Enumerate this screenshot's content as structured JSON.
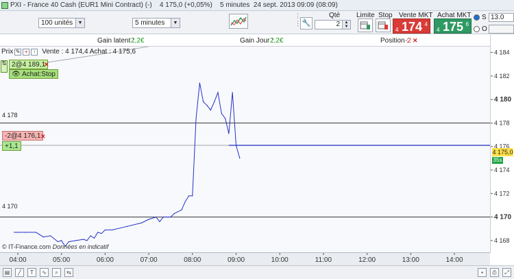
{
  "title": {
    "app": "PXI",
    "instrument": "France 40 Cash (EUR1 Mini Contract) (-)",
    "last": "4 175,0 (+0,05%)",
    "interval": "5 minutes",
    "datetime": "24 sept. 2013 09:09 (08:09)"
  },
  "toolbar": {
    "units_value": "100 unités",
    "timeframe_value": "5 minutes",
    "qty_label": "Qté",
    "qty_value": "2",
    "limit_label": "Limite",
    "stop_label": "Stop",
    "sell_label": "Vente MKT",
    "buy_label": "Achat MKT",
    "sell_prefix": "4",
    "sell_big": "174",
    "sell_suffix": "4",
    "buy_prefix": "4",
    "buy_big": "175",
    "buy_suffix": "6",
    "radio_s": "S",
    "radio_o": "O",
    "step_value": "13.0",
    "step_value2": "",
    "colors": {
      "sell": "#d93b36",
      "buy": "#2f9a63"
    }
  },
  "info": {
    "gain_latent_label": "Gain latent :",
    "gain_latent_value": "2,2€",
    "gain_jour_label": "Gain Jour :",
    "gain_jour_value": "2,2€",
    "position_label": "Position :",
    "position_value": "-2"
  },
  "panel": {
    "prix_label": "Prix",
    "quote": "Vente : 4 174,4 Achat : 4 175,6",
    "pos_order": "2@4 189,1",
    "stop_order": "Achat:Stop",
    "sell_order": "-2@4 176,1",
    "pnl": "+1,1",
    "watermark": "© IT-Finance.com",
    "watermark_note": "Données en indicatif"
  },
  "levels": {
    "line1_label": "4 178",
    "line2_label": "4 170",
    "current_price": "4 175,0",
    "current_badge": "35s"
  },
  "chart_data": {
    "type": "line",
    "title": "",
    "xlabel": "",
    "ylabel": "",
    "x_ticks": [
      "04:00",
      "05:00",
      "06:00",
      "07:00",
      "08:00",
      "09:00",
      "10:00",
      "11:00",
      "12:00",
      "13:00",
      "14:00"
    ],
    "y_ticks": [
      "4 184",
      "4 182",
      "4 180",
      "4 178",
      "4 176",
      "4 174",
      "4 172",
      "4 170",
      "4 168"
    ],
    "ylim": [
      4167,
      4184.5
    ],
    "horizontal_levels": [
      4178,
      4176.1,
      4170
    ],
    "series": [
      {
        "name": "",
        "color": "#2330c8",
        "points": [
          [
            "03:55",
            4168.7
          ],
          [
            "04:00",
            4168.7
          ],
          [
            "04:10",
            4168.7
          ],
          [
            "04:25",
            4168.7
          ],
          [
            "04:35",
            4168.3
          ],
          [
            "04:45",
            4168.4
          ],
          [
            "04:55",
            4167.9
          ],
          [
            "05:00",
            4168.0
          ],
          [
            "05:05",
            4167.5
          ],
          [
            "05:10",
            4167.9
          ],
          [
            "05:20",
            4168.0
          ],
          [
            "05:30",
            4168.1
          ],
          [
            "05:35",
            4168.0
          ],
          [
            "05:40",
            4168.4
          ],
          [
            "05:45",
            4168.2
          ],
          [
            "05:50",
            4168.7
          ],
          [
            "05:55",
            4168.6
          ],
          [
            "06:00",
            4168.9
          ],
          [
            "06:10",
            4168.9
          ],
          [
            "06:30",
            4169.2
          ],
          [
            "06:50",
            4169.5
          ],
          [
            "07:00",
            4169.8
          ],
          [
            "07:10",
            4170.0
          ],
          [
            "07:15",
            4169.6
          ],
          [
            "07:20",
            4170.0
          ],
          [
            "07:30",
            4170.0
          ],
          [
            "07:35",
            4170.3
          ],
          [
            "07:45",
            4170.6
          ],
          [
            "07:50",
            4171.3
          ],
          [
            "07:55",
            4171.8
          ],
          [
            "08:00",
            4171.8
          ],
          [
            "08:05",
            4178.4
          ],
          [
            "08:10",
            4181.4
          ],
          [
            "08:15",
            4179.8
          ],
          [
            "08:20",
            4179.5
          ],
          [
            "08:25",
            4179.1
          ],
          [
            "08:30",
            4179.8
          ],
          [
            "08:35",
            4180.6
          ],
          [
            "08:40",
            4178.8
          ],
          [
            "08:45",
            4178.4
          ],
          [
            "08:50",
            4177.1
          ],
          [
            "08:55",
            4180.6
          ],
          [
            "09:00",
            4176.1
          ],
          [
            "09:05",
            4175.0
          ]
        ]
      }
    ]
  },
  "bottom": {
    "icons": [
      "chart-type-icon",
      "draw-line-icon",
      "text-tool-icon",
      "indicator-icon",
      "zoom-icon",
      "compare-icon",
      "save-icon",
      "print-icon"
    ]
  }
}
